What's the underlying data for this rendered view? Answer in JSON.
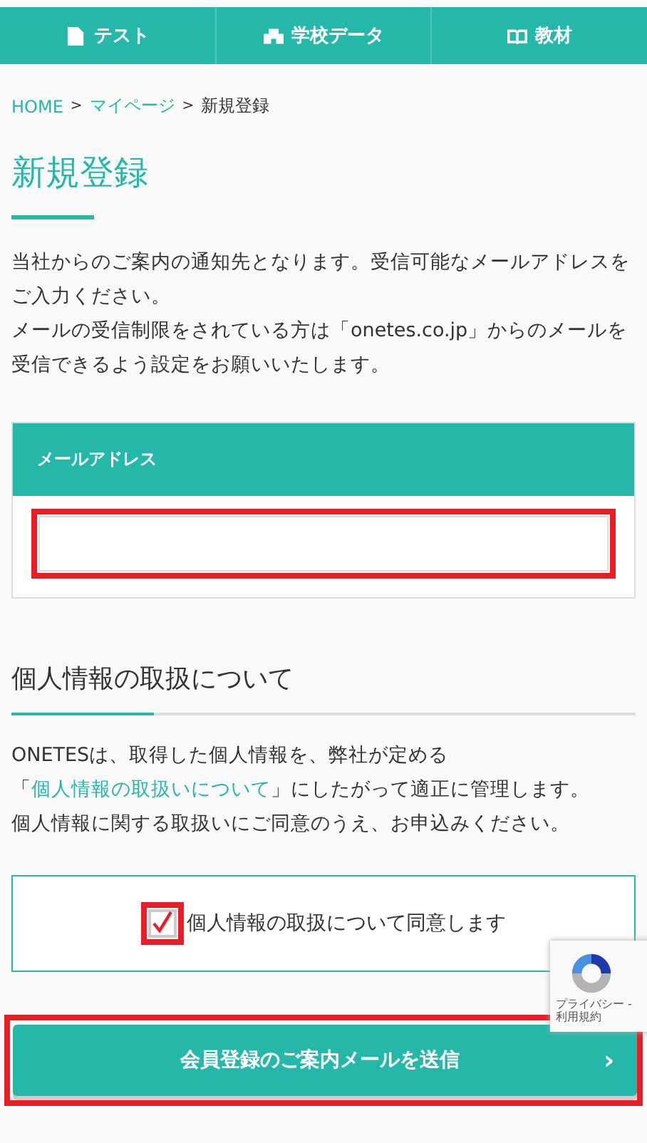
{
  "nav": [
    {
      "label": "テスト",
      "kind": "document"
    },
    {
      "label": "学校データ",
      "kind": "school"
    },
    {
      "label": "教材",
      "kind": "book"
    }
  ],
  "breadcrumb": [
    {
      "label": "HOME",
      "link": true
    },
    {
      "label": "マイページ",
      "link": true
    },
    {
      "label": "新規登録",
      "link": false
    }
  ],
  "breadcrumb_separator": ">",
  "title": "新規登録",
  "intro": [
    "当社からのご案内の通知先となります。受信可能なメールアドレスをご入力ください。",
    "メールの受信制限をされている方は「onetes.co.jp」からのメールを受信できるよう設定をお願いいたします。"
  ],
  "email": {
    "label": "メールアドレス",
    "highlighted": true
  },
  "privacy": {
    "heading": "個人情報の取扱について",
    "text_before": "ONETESは、取得した個人情報を、弊社が定める「",
    "link": "個人情報の取扱いについて",
    "text_after": "」にしたがって適正に管理します。",
    "note": "個人情報に関する取扱いにご同意のうえ、お申込みください。"
  },
  "consent": {
    "label": "個人情報の取扱について同意します",
    "checked": true,
    "highlighted": true
  },
  "submit": {
    "label": "会員登録のご案内メールを送信",
    "arrow": "›",
    "highlighted": true
  },
  "recaptcha": {
    "text": "プライバシー - 利用規約"
  }
}
